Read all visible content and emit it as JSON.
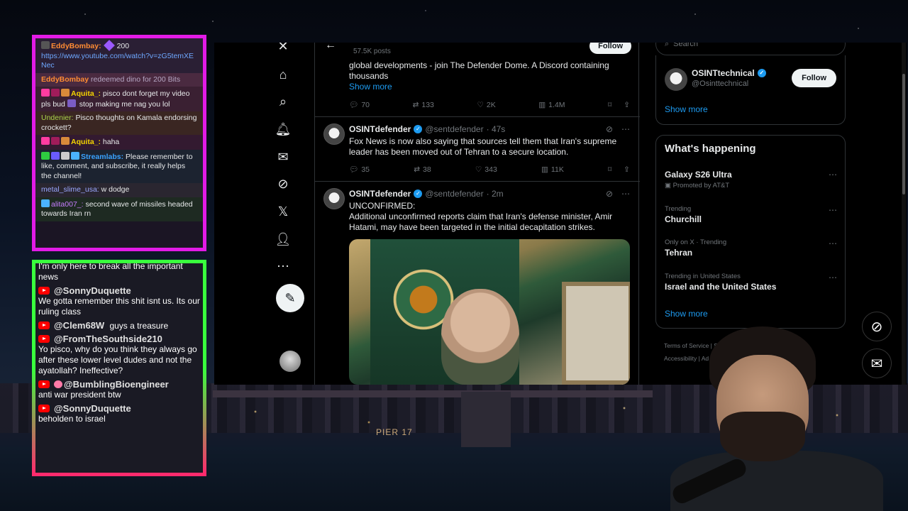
{
  "chat_top": {
    "messages": [
      {
        "user": "EddyBombay:",
        "bits": "200",
        "link": "https://www.youtube.com/watch?v=zG5temXENec"
      },
      {
        "user": "EddyBombay",
        "text": " redeemed dino for 200 Bits"
      },
      {
        "user": "Aquita_:",
        "text": " pisco dont forget my video pls bud ",
        "text2": " stop making me nag you lol"
      },
      {
        "user": "Undenier:",
        "text": " Pisco thoughts on Kamala endorsing crockett?"
      },
      {
        "user": "Aquita_:",
        "text": " haha"
      },
      {
        "user": "Streamlabs:",
        "text": " Please remember to like, comment, and subscribe, it really helps the channel!"
      },
      {
        "user": "metal_slime_usa:",
        "text": " w dodge"
      },
      {
        "user": "alita007_:",
        "text": " second wave of missiles headed towards Iran rn"
      }
    ]
  },
  "chat_bottom": {
    "partial_top": "I'm only here to break all the important news",
    "items": [
      {
        "author": "@SonnyDuquette",
        "text": "We gotta remember this shit isnt us. Its our ruling class"
      },
      {
        "author": "@Clem68W",
        "inline": "guys a treasure"
      },
      {
        "author": "@FromTheSouthside210",
        "text": "Yo pisco, why do you think they always go after these lower level dudes and not the ayatollah? Ineffective?"
      },
      {
        "author": "@BumblingBioengineer",
        "text": "anti war president btw"
      },
      {
        "author": "@SonnyDuquette",
        "text": "beholden to israel"
      }
    ]
  },
  "x": {
    "nav_icons": [
      "x-logo-icon",
      "home-icon",
      "search-icon",
      "bell-icon",
      "mail-icon",
      "grok-icon",
      "x-premium-icon",
      "profile-icon",
      "more-icon"
    ],
    "header": {
      "posts_count": "57.5K posts",
      "follow_label": "Follow"
    },
    "tweet0": {
      "text": "global developments - join The Defender Dome. A Discord containing thousands",
      "show_more": "Show more",
      "replies": "70",
      "reposts": "133",
      "likes": "2K",
      "views": "1.4M"
    },
    "tweet1": {
      "name": "OSINTdefender",
      "handle": "@sentdefender",
      "time": "· 47s",
      "text": "Fox News is now also saying that sources tell them that Iran's supreme leader has been moved out of Tehran to a secure location.",
      "replies": "35",
      "reposts": "38",
      "likes": "343",
      "views": "11K"
    },
    "tweet2": {
      "name": "OSINTdefender",
      "handle": "@sentdefender",
      "time": "· 2m",
      "line1": "UNCONFIRMED:",
      "text": "Additional unconfirmed reports claim that Iran's defense minister, Amir Hatami, may have been targeted in the initial decapitation strikes."
    },
    "right": {
      "search_placeholder": "Search",
      "who": {
        "name": "OSINTtechnical",
        "handle": "@Osinttechnical",
        "follow": "Follow",
        "show_more": "Show more"
      },
      "happening": {
        "title": "What's happening",
        "trends": [
          {
            "context": "",
            "topic": "Galaxy S26 Ultra",
            "sub": "Promoted by AT&T"
          },
          {
            "context": "Trending",
            "topic": "Churchill"
          },
          {
            "context": "Only on X · Trending",
            "topic": "Tehran"
          },
          {
            "context": "Trending in United States",
            "topic": "Israel and the United States"
          }
        ],
        "show_more": "Show more"
      },
      "footer": {
        "line1": "Terms of Service  |  S",
        "line2": "Accessibility  |  Ad"
      }
    }
  },
  "background": {
    "sign": "PIER 17"
  }
}
